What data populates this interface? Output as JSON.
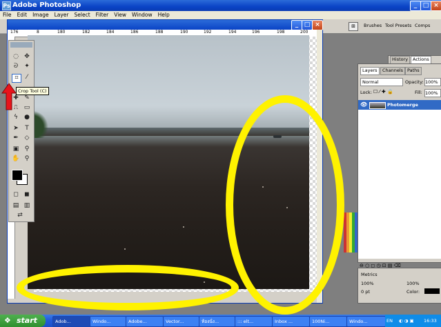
{
  "app": {
    "title": "Adobe Photoshop"
  },
  "menu": [
    "File",
    "Edit",
    "Image",
    "Layer",
    "Select",
    "Filter",
    "View",
    "Window",
    "Help"
  ],
  "options_bar": {
    "tabs": [
      "Brushes",
      "Tool Presets",
      "Comps"
    ]
  },
  "ruler": {
    "ticks": [
      "176",
      "8",
      "180",
      "182",
      "184",
      "186",
      "188",
      "190",
      "192",
      "194",
      "196",
      "198",
      "200"
    ]
  },
  "toolbox": {
    "tooltip": "Crop Tool (C)"
  },
  "panels": {
    "history_tabs": [
      "History",
      "Actions"
    ],
    "layers_tabs": [
      "Layers",
      "Channels",
      "Paths"
    ],
    "blend_mode": "Normal",
    "opacity_label": "Opacity:",
    "opacity_value": "100%",
    "lock_label": "Lock:",
    "fill_label": "Fill:",
    "fill_value": "100%",
    "layer_name": "Photomerge",
    "char_font": "Metrics",
    "char_size1": "100%",
    "char_size2": "100%",
    "char_tracking": "0 pt",
    "color_label": "Color:"
  },
  "taskbar": {
    "start": "start",
    "tasks": [
      "Adob...",
      "Windo...",
      "Adobe...",
      "Vector...",
      "ห้องนั่ง...",
      "::: elt...",
      "Inbox ...",
      "100Ni...",
      "Windo..."
    ],
    "lang": "EN",
    "clock": "16:33"
  },
  "colors": {
    "annotation": "#fff200",
    "arrow": "#e8141b",
    "xp_blue": "#0a43c6"
  }
}
